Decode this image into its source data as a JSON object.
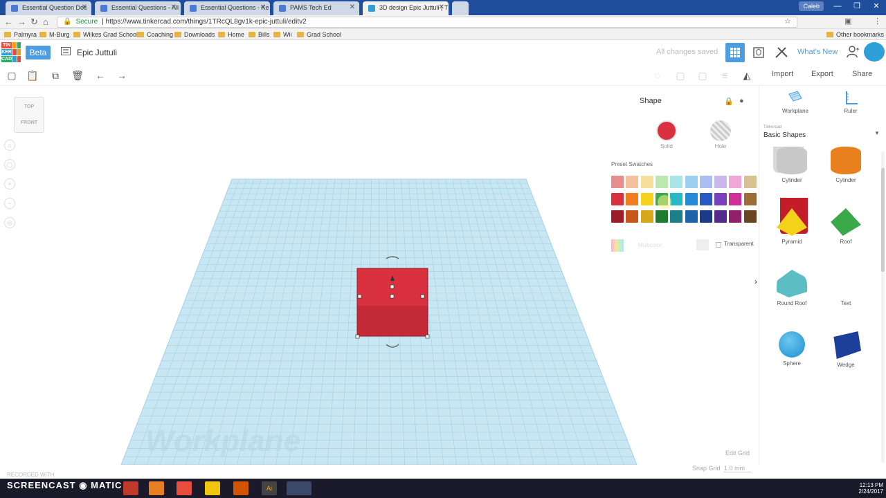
{
  "browser": {
    "tabs": [
      {
        "title": "Essential Question Doc",
        "active": false
      },
      {
        "title": "Essential Questions - All",
        "active": false
      },
      {
        "title": "Essential Questions - Ke",
        "active": false
      },
      {
        "title": "PAMS Tech Ed",
        "active": false
      },
      {
        "title": "3D design Epic Juttuli | T",
        "active": true
      }
    ],
    "user_chip": "Caleb",
    "url_secure": "Secure",
    "url": "https://www.tinkercad.com/things/1TRcQL8gv1k-epic-juttuli/editv2",
    "bookmarks": [
      "Palmyra",
      "M-Burg",
      "Wilkes Grad School",
      "Coaching",
      "Downloads",
      "Home",
      "Bills",
      "Wii",
      "Grad School"
    ],
    "other_bookmarks": "Other bookmarks"
  },
  "header": {
    "logo_letters": [
      "TIN",
      "KER",
      "CAD"
    ],
    "beta": "Beta",
    "design_title": "Epic Juttuli",
    "saved_status": "All changes saved",
    "whats_new": "What's New"
  },
  "toolbar": {
    "import": "Import",
    "export": "Export",
    "share": "Share"
  },
  "viewcube": {
    "top": "TOP",
    "front": "FRONT"
  },
  "workplane": {
    "label": "Workplane",
    "edit_grid": "Edit Grid",
    "snap_grid_label": "Snap Grid",
    "snap_grid_value": "1.0 mm"
  },
  "inspector": {
    "title": "Shape",
    "solid_label": "Solid",
    "hole_label": "Hole",
    "solid_color": "#d9313f",
    "preset_label": "Preset Swatches",
    "swatches": [
      [
        "#e88d8d",
        "#f4c19a",
        "#f6df9c",
        "#bde7b0",
        "#a8e5e6",
        "#9dcff0",
        "#a8bff0",
        "#c9b8ec",
        "#f0a6d6",
        "#d9c192",
        "",
        "#a9a9a9"
      ],
      [
        "#d9313f",
        "#f07d1e",
        "#f6d21f",
        "#3aa949",
        "#26b8c4",
        "#2389d8",
        "#2b58c4",
        "#7a3fbf",
        "#d12e9a",
        "#9b6b3a",
        "",
        "#666666"
      ],
      [
        "#9c1c28",
        "#c8551b",
        "#d8a81a",
        "#207a30",
        "#1b7f8a",
        "#1c63a8",
        "#1c3a8a",
        "#542a8a",
        "#92206b",
        "#6b4522",
        "",
        "#222222"
      ]
    ],
    "multicolor_label": "Multicolor",
    "transparent_label": "Transparent"
  },
  "right_panel": {
    "workplane": "Workplane",
    "ruler": "Ruler",
    "library_brand": "Tinkercad",
    "library_name": "Basic Shapes",
    "shapes": [
      {
        "name": "Cylinder",
        "color": "#c8c8c8"
      },
      {
        "name": "Cylinder",
        "color": "#e8801e"
      },
      {
        "name": "Pyramid",
        "color": "#f2d21a"
      },
      {
        "name": "Roof",
        "color": "#3aa949"
      },
      {
        "name": "Round Roof",
        "color": "#5cbdc4"
      },
      {
        "name": "Text",
        "color": "#c41c28"
      },
      {
        "name": "Sphere",
        "color": "#1f8fd0"
      },
      {
        "name": "Wedge",
        "color": "#1c3f9a"
      }
    ]
  },
  "taskbar": {
    "watermark": "RECORDED WITH",
    "brand": "SCREENCAST",
    "brand_suffix": "MATIC",
    "time": "12:13 PM",
    "date": "2/24/2017"
  }
}
